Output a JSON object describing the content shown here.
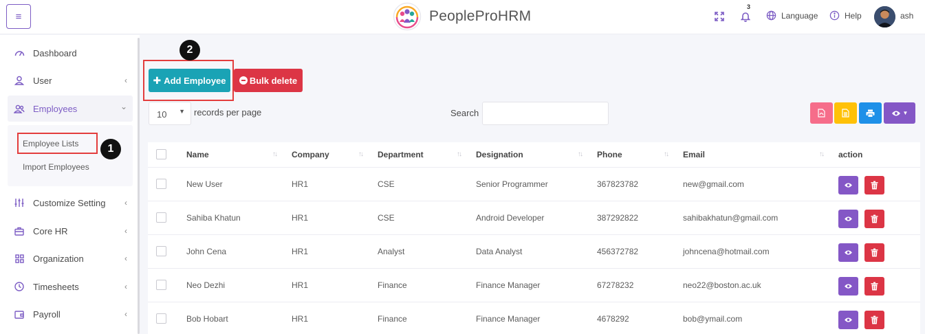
{
  "app": {
    "title": "PeopleProHRM"
  },
  "header": {
    "language_label": "Language",
    "help_label": "Help",
    "user_name": "ash",
    "notification_count": "3",
    "icons": [
      "menu-icon",
      "expand-icon",
      "bell-icon",
      "globe-icon",
      "info-icon"
    ]
  },
  "sidebar": {
    "items": [
      {
        "label": "Dashboard",
        "icon": "gauge-icon"
      },
      {
        "label": "User",
        "icon": "user-icon",
        "chevron": "‹"
      },
      {
        "label": "Employees",
        "icon": "users-icon",
        "chevron": "⌄"
      },
      {
        "label": "Customize Setting",
        "icon": "sliders-icon",
        "chevron": "‹"
      },
      {
        "label": "Core HR",
        "icon": "briefcase-icon",
        "chevron": "‹"
      },
      {
        "label": "Organization",
        "icon": "grid-icon",
        "chevron": "‹"
      },
      {
        "label": "Timesheets",
        "icon": "clock-icon",
        "chevron": "‹"
      },
      {
        "label": "Payroll",
        "icon": "wallet-icon",
        "chevron": "‹"
      }
    ],
    "submenu": [
      {
        "label": "Employee Lists"
      },
      {
        "label": "Import Employees"
      }
    ]
  },
  "annotations": {
    "step1": "1",
    "step2": "2"
  },
  "toolbar": {
    "add_label": "Add Employee",
    "bulk_label": "Bulk delete",
    "records_value": "10",
    "records_label": "records per page",
    "search_label": "Search"
  },
  "table": {
    "headers": [
      "Name",
      "Company",
      "Department",
      "Designation",
      "Phone",
      "Email",
      "action"
    ],
    "rows": [
      [
        "New User",
        "HR1",
        "CSE",
        "Senior Programmer",
        "367823782",
        "new@gmail.com"
      ],
      [
        "Sahiba Khatun",
        "HR1",
        "CSE",
        "Android Developer",
        "387292822",
        "sahibakhatun@gmail.com"
      ],
      [
        "John Cena",
        "HR1",
        "Analyst",
        "Data Analyst",
        "456372782",
        "johncena@hotmail.com"
      ],
      [
        "Neo Dezhi",
        "HR1",
        "Finance",
        "Finance Manager",
        "67278232",
        "neo22@boston.ac.uk"
      ],
      [
        "Bob Hobart",
        "HR1",
        "Finance",
        "Finance Manager",
        "4678292",
        "bob@ymail.com"
      ]
    ]
  },
  "colors": {
    "accent": "#7c5cc4",
    "teal": "#1aa3b5",
    "danger": "#dc3545",
    "pdf": "#f66d8a",
    "csv": "#ffc107",
    "print": "#1e90e8",
    "visibility": "#8457c6",
    "annotation": "#e33c3c"
  }
}
